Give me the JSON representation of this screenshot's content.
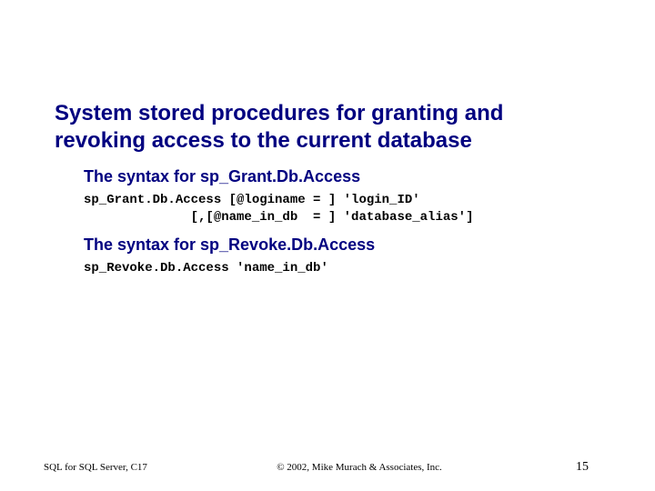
{
  "title": "System stored procedures for granting and revoking access to the current database",
  "sections": [
    {
      "heading": "The syntax for sp_Grant.Db.Access",
      "code": "sp_Grant.Db.Access [@loginame = ] 'login_ID'\n              [,[@name_in_db  = ] 'database_alias']"
    },
    {
      "heading": "The syntax for sp_Revoke.Db.Access",
      "code": "sp_Revoke.Db.Access 'name_in_db'"
    }
  ],
  "footer": {
    "left": "SQL for SQL Server, C17",
    "center": "© 2002, Mike Murach & Associates, Inc.",
    "right": "15"
  }
}
